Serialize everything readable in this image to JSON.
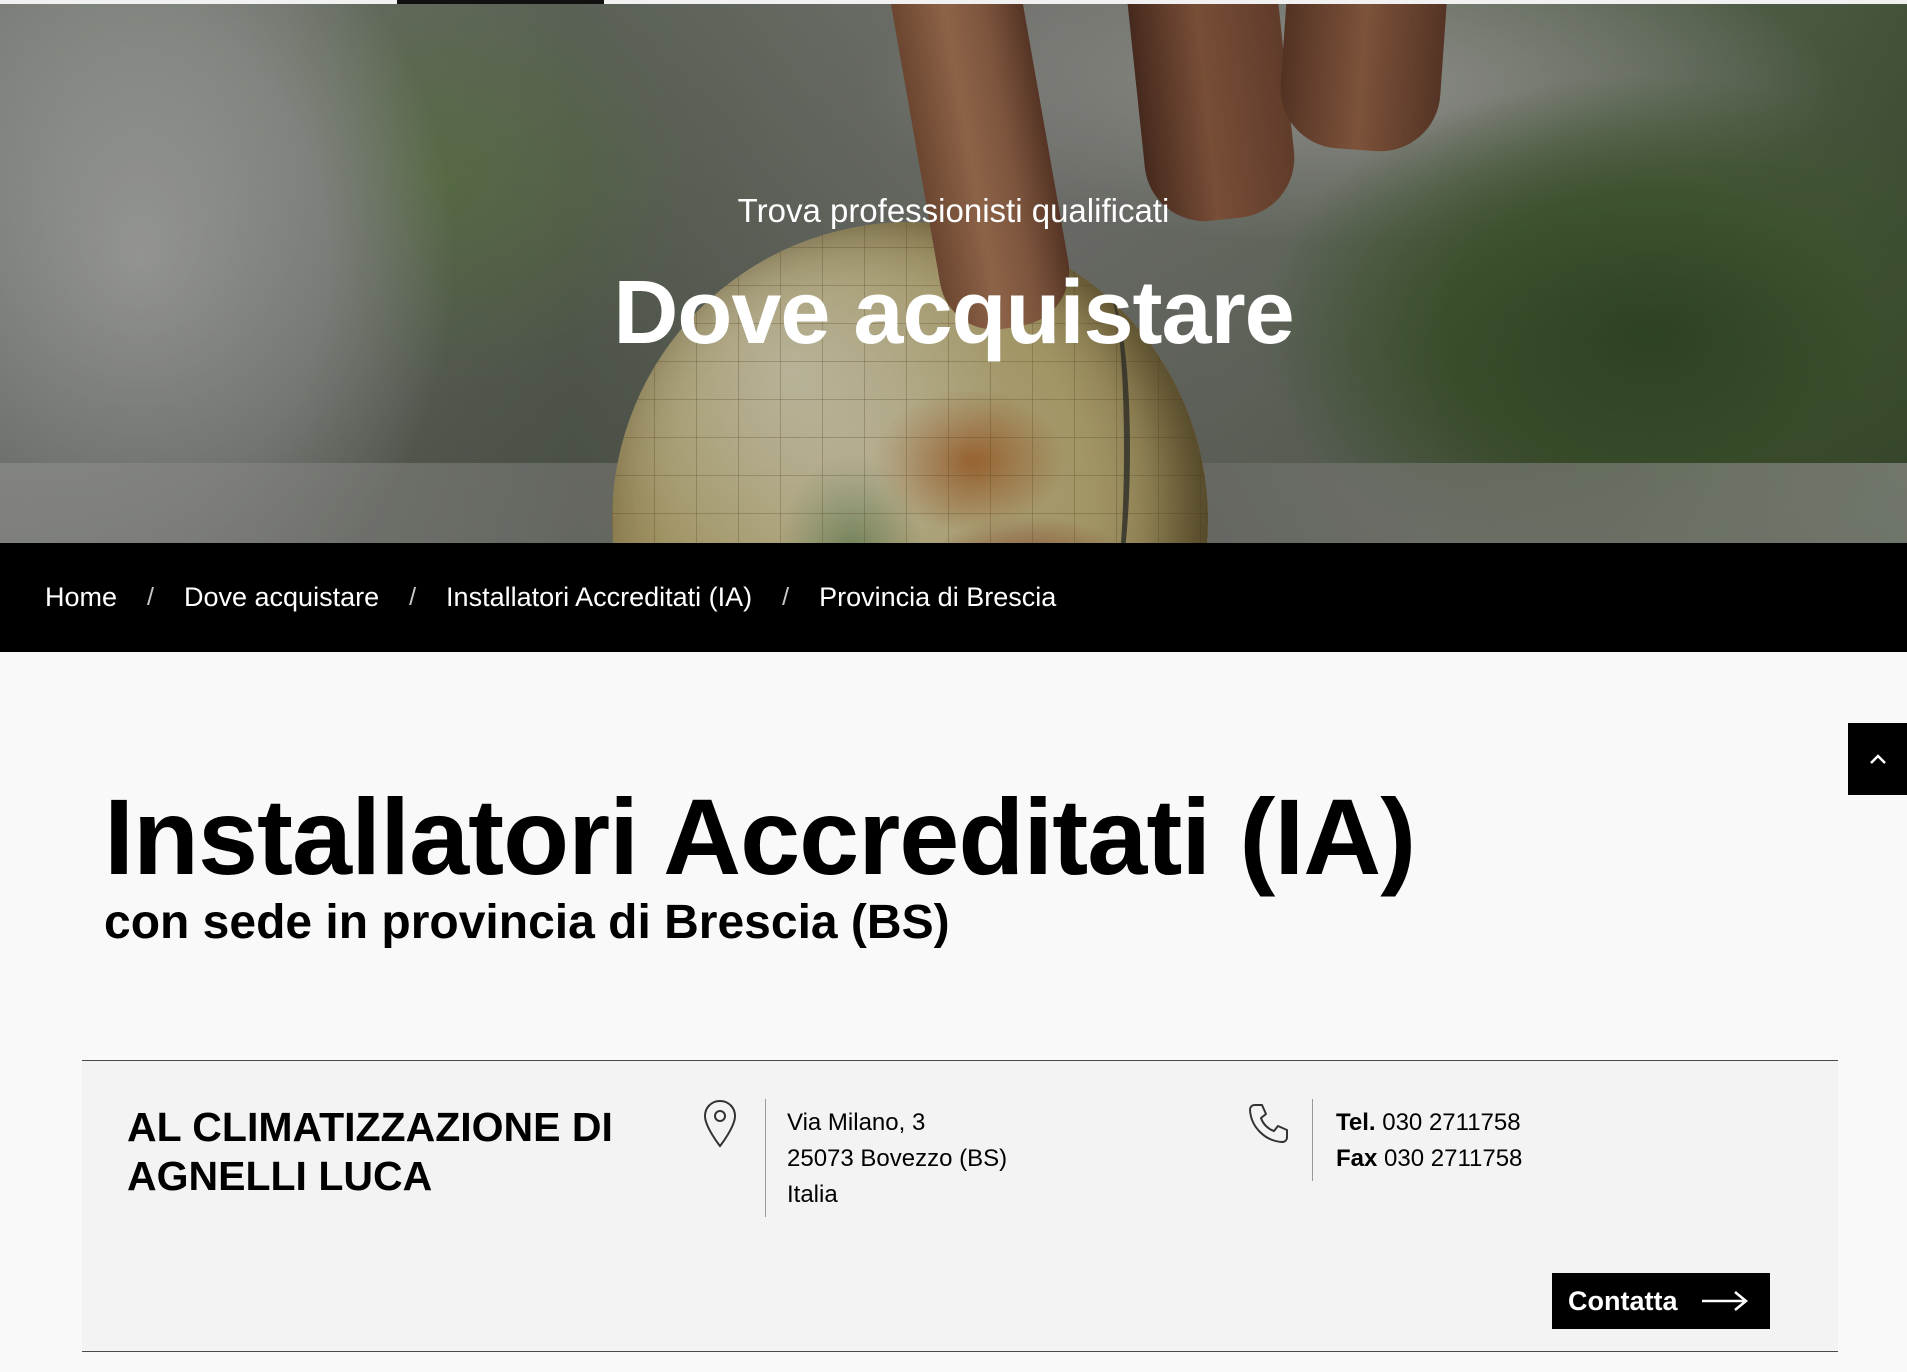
{
  "hero": {
    "kicker": "Trova professionisti qualificati",
    "title": "Dove acquistare"
  },
  "breadcrumb": {
    "items": [
      {
        "label": "Home"
      },
      {
        "label": "Dove acquistare"
      },
      {
        "label": "Installatori Accreditati (IA)"
      },
      {
        "label": "Provincia di Brescia"
      }
    ],
    "separator": "/"
  },
  "page": {
    "title": "Installatori Accreditati (IA)",
    "subtitle": "con sede in provincia di Brescia (BS)"
  },
  "listing": {
    "name": "AL CLIMATIZZAZIONE DI AGNELLI LUCA",
    "address": {
      "street": "Via Milano, 3",
      "city": "25073 Bovezzo (BS)",
      "country": "Italia"
    },
    "contacts": {
      "tel_label": "Tel.",
      "tel_value": "030 2711758",
      "fax_label": "Fax",
      "fax_value": "030 2711758"
    },
    "cta_label": "Contatta"
  },
  "icons": {
    "location": "map-pin-icon",
    "phone": "phone-icon",
    "arrow": "arrow-right-icon",
    "scroll_top": "chevron-up-icon"
  },
  "colors": {
    "breadcrumb_bg": "#000000",
    "page_bg": "#f9f9f9",
    "card_bg": "#f3f3f3",
    "button_bg": "#000000",
    "text": "#000000"
  }
}
